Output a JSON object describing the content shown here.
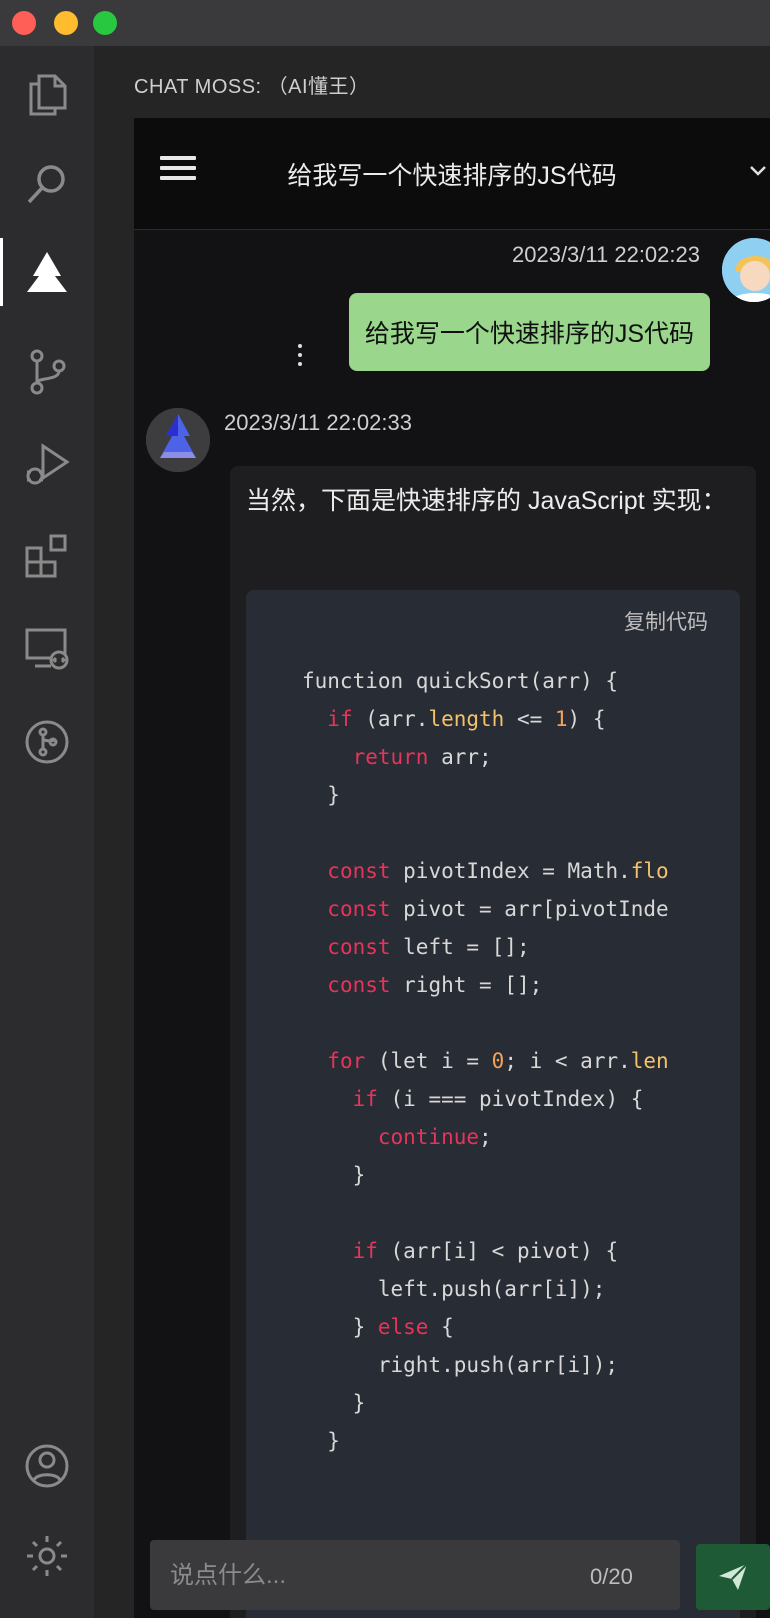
{
  "window": {
    "traffic_lights": [
      "close",
      "minimize",
      "zoom"
    ]
  },
  "activity_bar": {
    "items": [
      {
        "icon": "files-icon"
      },
      {
        "icon": "search-icon"
      },
      {
        "icon": "chat-moss-icon",
        "active": true
      },
      {
        "icon": "source-control-icon"
      },
      {
        "icon": "run-debug-icon"
      },
      {
        "icon": "extensions-icon"
      },
      {
        "icon": "remote-explorer-icon"
      },
      {
        "icon": "git-graph-icon"
      }
    ],
    "bottom": [
      {
        "icon": "account-icon"
      },
      {
        "icon": "settings-gear-icon"
      }
    ]
  },
  "panel": {
    "title": "CHAT MOSS: （AI懂王）"
  },
  "conversation": {
    "title": "给我写一个快速排序的JS代码"
  },
  "messages": {
    "user": {
      "timestamp": "2023/3/11 22:02:23",
      "text": "给我写一个快速排序的JS代码"
    },
    "ai": {
      "timestamp": "2023/3/11 22:02:33",
      "text": "当然，下面是快速排序的 JavaScript 实现：",
      "copy_label": "复制代码",
      "code_lines": [
        [
          {
            "t": "function quickSort(arr) {",
            "c": ""
          }
        ],
        [
          {
            "t": "  ",
            "c": ""
          },
          {
            "t": "if",
            "c": "kw"
          },
          {
            "t": " (arr.",
            "c": ""
          },
          {
            "t": "length",
            "c": "prop"
          },
          {
            "t": " <= ",
            "c": ""
          },
          {
            "t": "1",
            "c": "num"
          },
          {
            "t": ") {",
            "c": ""
          }
        ],
        [
          {
            "t": "    ",
            "c": ""
          },
          {
            "t": "return",
            "c": "kw"
          },
          {
            "t": " arr;",
            "c": ""
          }
        ],
        [
          {
            "t": "  }",
            "c": ""
          }
        ],
        [
          {
            "t": "",
            "c": ""
          }
        ],
        [
          {
            "t": "  ",
            "c": ""
          },
          {
            "t": "const",
            "c": "kw"
          },
          {
            "t": " pivotIndex = Math.",
            "c": ""
          },
          {
            "t": "flo",
            "c": "prop"
          }
        ],
        [
          {
            "t": "  ",
            "c": ""
          },
          {
            "t": "const",
            "c": "kw"
          },
          {
            "t": " pivot = arr[pivotInde",
            "c": ""
          }
        ],
        [
          {
            "t": "  ",
            "c": ""
          },
          {
            "t": "const",
            "c": "kw"
          },
          {
            "t": " left = [];",
            "c": ""
          }
        ],
        [
          {
            "t": "  ",
            "c": ""
          },
          {
            "t": "const",
            "c": "kw"
          },
          {
            "t": " right = [];",
            "c": ""
          }
        ],
        [
          {
            "t": "",
            "c": ""
          }
        ],
        [
          {
            "t": "  ",
            "c": ""
          },
          {
            "t": "for",
            "c": "kw"
          },
          {
            "t": " (let i = ",
            "c": ""
          },
          {
            "t": "0",
            "c": "num"
          },
          {
            "t": "; i < arr.",
            "c": ""
          },
          {
            "t": "len",
            "c": "prop"
          }
        ],
        [
          {
            "t": "    ",
            "c": ""
          },
          {
            "t": "if",
            "c": "kw"
          },
          {
            "t": " (i === pivotIndex) {",
            "c": ""
          }
        ],
        [
          {
            "t": "      ",
            "c": ""
          },
          {
            "t": "continue",
            "c": "kw"
          },
          {
            "t": ";",
            "c": ""
          }
        ],
        [
          {
            "t": "    }",
            "c": ""
          }
        ],
        [
          {
            "t": "",
            "c": ""
          }
        ],
        [
          {
            "t": "    ",
            "c": ""
          },
          {
            "t": "if",
            "c": "kw"
          },
          {
            "t": " (arr[i] < pivot) {",
            "c": ""
          }
        ],
        [
          {
            "t": "      left.push(arr[i]);",
            "c": ""
          }
        ],
        [
          {
            "t": "    } ",
            "c": ""
          },
          {
            "t": "else",
            "c": "kw"
          },
          {
            "t": " {",
            "c": ""
          }
        ],
        [
          {
            "t": "      right.push(arr[i]);",
            "c": ""
          }
        ],
        [
          {
            "t": "    }",
            "c": ""
          }
        ],
        [
          {
            "t": "  }",
            "c": ""
          }
        ]
      ]
    }
  },
  "composer": {
    "placeholder": "说点什么...",
    "value": "",
    "counter": "0/20",
    "send_icon": "send-icon"
  },
  "colors": {
    "user_bubble": "#9ad78d",
    "keyword": "#e8345a",
    "property": "#f4c26a",
    "number": "#f4a259",
    "send_button": "#1f5a36"
  }
}
